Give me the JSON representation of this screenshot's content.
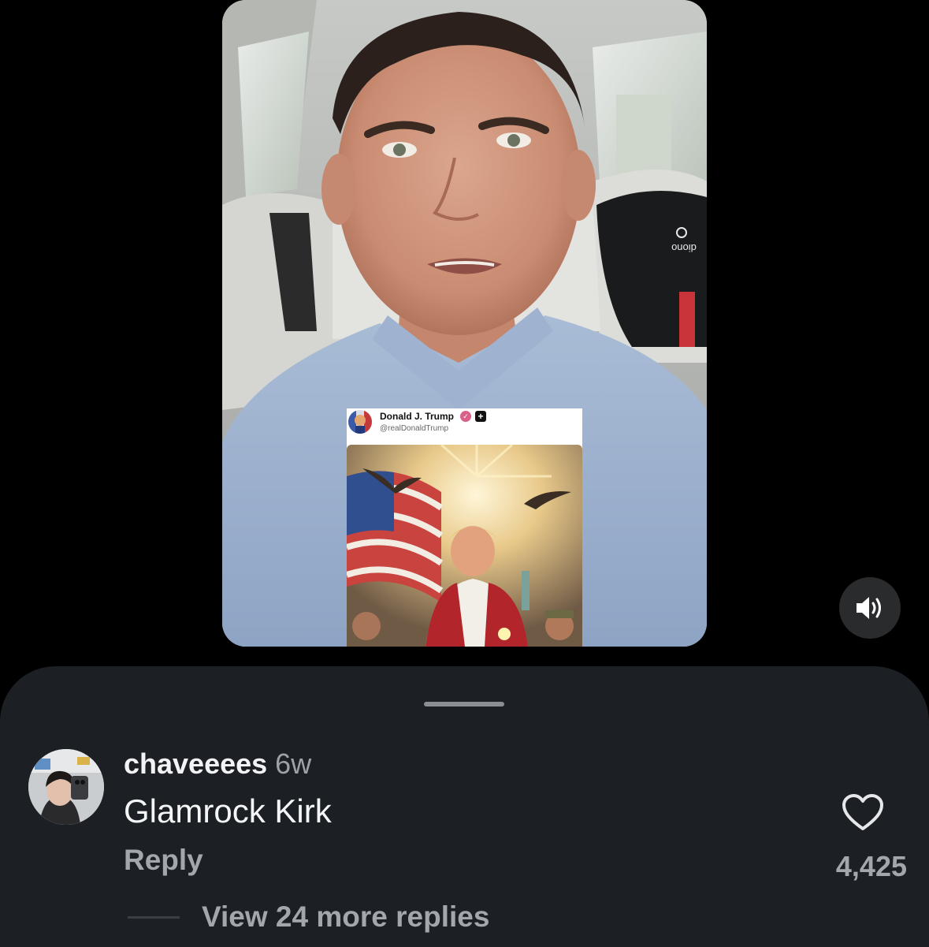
{
  "video": {
    "post": {
      "author_name": "Donald J. Trump",
      "author_handle": "@realDonaldTrump",
      "verified_badge": "verified-check-icon",
      "badge_symbol": "+"
    },
    "seat_brand": "diono",
    "mute_icon": "speaker-icon"
  },
  "comment": {
    "username": "chaveeees",
    "timestamp": "6w",
    "text": "Glamrock Kirk",
    "reply_label": "Reply",
    "like_count": "4,425",
    "view_replies_label": "View 24 more replies"
  },
  "colors": {
    "background": "#000000",
    "sheet": "#1c1f23",
    "primary_text": "#f4f5f7",
    "secondary_text": "#a3a7ad",
    "verified": "#d9608a"
  }
}
